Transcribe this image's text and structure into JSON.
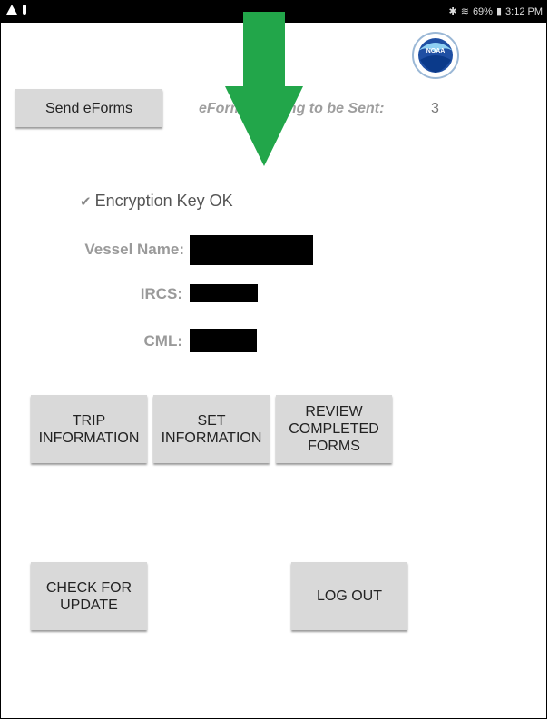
{
  "status_bar": {
    "battery": "69%",
    "time": "3:12 PM"
  },
  "logo": {
    "text": "NOAA"
  },
  "send": {
    "button_label": "Send eForms",
    "pending_label": "eForms waiting to be Sent:",
    "pending_count": "3"
  },
  "encryption": {
    "label": "Encryption Key OK",
    "checked": true
  },
  "vessel": {
    "name_label": "Vessel Name:",
    "ircs_label": "IRCS:",
    "cml_label": "CML:"
  },
  "actions": {
    "trip": "TRIP\nINFORMATION",
    "set": "SET\nINFORMATION",
    "review": "REVIEW\nCOMPLETED\nFORMS",
    "check_update": "CHECK FOR\nUPDATE",
    "logout": "LOG OUT"
  },
  "colors": {
    "arrow": "#22a64a",
    "button_bg": "#d9d9d9",
    "label_gray": "#9a9a9a"
  }
}
